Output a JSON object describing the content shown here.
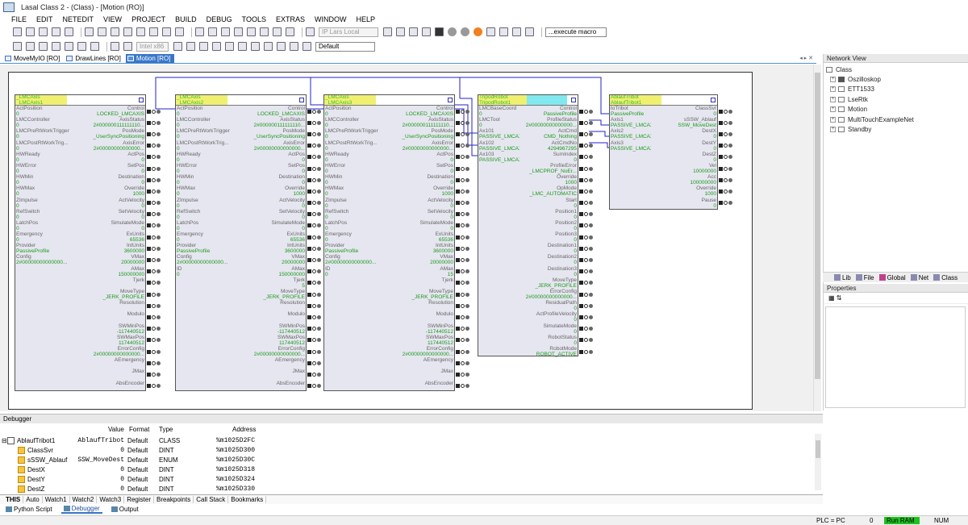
{
  "window": {
    "title": "Lasal Class 2 - (Class) - [Motion (RO)]"
  },
  "menu": [
    "FILE",
    "EDIT",
    "NETEDIT",
    "VIEW",
    "PROJECT",
    "BUILD",
    "DEBUG",
    "TOOLS",
    "EXTRAS",
    "WINDOW",
    "HELP"
  ],
  "toolbar": {
    "target": "IP Lars Local",
    "macro": "...execute macro",
    "platform": "Intel x86",
    "config": "Default"
  },
  "doc_tabs": [
    {
      "label": "MoveMyIO [RO]"
    },
    {
      "label": "DrawLines [RO]"
    },
    {
      "label": "Motion [RO]",
      "active": true
    }
  ],
  "blocks": [
    {
      "name1": "_LMCAxis",
      "name2": "_LMCAxis1",
      "left": [
        [
          "ActPosition",
          "0"
        ],
        [
          "LMCController",
          "0"
        ],
        [
          "LMCPreRtWorkTrigger",
          "0"
        ],
        [
          "LMCPostRtWorkTrig...",
          "0"
        ],
        [
          "HWReady",
          "0"
        ],
        [
          "HWError",
          "0"
        ],
        [
          "HWMin",
          "0"
        ],
        [
          "HWMax",
          "0"
        ],
        [
          "ZImpulse",
          "0"
        ],
        [
          "RefSwitch",
          "0"
        ],
        [
          "LatchPos",
          "0"
        ],
        [
          "Emergency",
          "0"
        ],
        [
          "Provider",
          "PassiveProfile"
        ],
        [
          "Config",
          "2#00000000000000..."
        ]
      ],
      "right": [
        [
          "Control",
          "LOCKED_LMCAXIS"
        ],
        [
          "AxisStatus",
          "2#000000111111110..."
        ],
        [
          "PosMode",
          "_UserSyncPositioning"
        ],
        [
          "AxisError",
          "2#00000000000000..."
        ],
        [
          "ActPos",
          "0"
        ],
        [
          "SetPos",
          "0"
        ],
        [
          "Destination",
          "0"
        ],
        [
          "Override",
          "1000"
        ],
        [
          "ActVelocity",
          "0"
        ],
        [
          "SetVelocity",
          "0"
        ],
        [
          "SimulateMode",
          "0"
        ],
        [
          "ExUnits",
          "65536"
        ],
        [
          "IntUnits",
          "3600000"
        ],
        [
          "VMax",
          "20000000"
        ],
        [
          "AMax",
          "150000000"
        ],
        [
          "Tjerk",
          ""
        ],
        [
          "MoveType",
          "_JERK_PROFILE"
        ],
        [
          "Resolution",
          ""
        ],
        [
          "Modulo",
          ""
        ],
        [
          "SWMinPos",
          "-117440512"
        ],
        [
          "SWMaxPos",
          "117440512"
        ],
        [
          "ErrorConfig",
          "2#00000000000000..."
        ],
        [
          "AEmergency",
          ""
        ],
        [
          "JMax",
          ""
        ],
        [
          "AbsEncoder",
          ""
        ]
      ]
    },
    {
      "name1": "_LMCAxis",
      "name2": "_LMCAxis2",
      "left": [
        [
          "ActPosition",
          "0"
        ],
        [
          "LMCController",
          "0"
        ],
        [
          "LMCPreRtWorkTrigger",
          "0"
        ],
        [
          "LMCPostRtWorkTrig...",
          "0"
        ],
        [
          "HWReady",
          "0"
        ],
        [
          "HWError",
          "0"
        ],
        [
          "HWMin",
          "0"
        ],
        [
          "HWMax",
          "0"
        ],
        [
          "ZImpulse",
          "0"
        ],
        [
          "RefSwitch",
          "0"
        ],
        [
          "LatchPos",
          "0"
        ],
        [
          "Emergency",
          "0"
        ],
        [
          "Provider",
          "PassiveProfile"
        ],
        [
          "Config",
          "2#00000000000000..."
        ],
        [
          "ID",
          "0"
        ]
      ],
      "right": [
        [
          "Control",
          "LOCKED_LMCAXIS"
        ],
        [
          "AxisStatus",
          "2#000000111111110..."
        ],
        [
          "PosMode",
          "_UserSyncPositioning"
        ],
        [
          "AxisError",
          "2#00000000000000..."
        ],
        [
          "ActPos",
          "0"
        ],
        [
          "SetPos",
          "0"
        ],
        [
          "Destination",
          "0"
        ],
        [
          "Override",
          "1000"
        ],
        [
          "ActVelocity",
          "0"
        ],
        [
          "SetVelocity",
          "0"
        ],
        [
          "SimulateMode",
          "0"
        ],
        [
          "ExUnits",
          "65536"
        ],
        [
          "IntUnits",
          "3600000"
        ],
        [
          "VMax",
          "20000000"
        ],
        [
          "AMax",
          "150000000"
        ],
        [
          "Tjerk",
          "5"
        ],
        [
          "MoveType",
          "_JERK_PROFILE"
        ],
        [
          "Resolution",
          ""
        ],
        [
          "Modulo",
          ""
        ],
        [
          "SWMinPos",
          "-117440512"
        ],
        [
          "SWMaxPos",
          "117440512"
        ],
        [
          "ErrorConfig",
          "2#00000000000000..."
        ],
        [
          "AEmergency",
          ""
        ],
        [
          "JMax",
          ""
        ],
        [
          "AbsEncoder",
          ""
        ]
      ]
    },
    {
      "name1": "_LMCAxis",
      "name2": "_LMCAxis3",
      "left": [
        [
          "ActPosition",
          "0"
        ],
        [
          "LMCController",
          "0"
        ],
        [
          "LMCPreRtWorkTrigger",
          "0"
        ],
        [
          "LMCPostRtWorkTrig...",
          "0"
        ],
        [
          "HWReady",
          "0"
        ],
        [
          "HWError",
          "0"
        ],
        [
          "HWMin",
          "0"
        ],
        [
          "HWMax",
          "0"
        ],
        [
          "ZImpulse",
          "0"
        ],
        [
          "RefSwitch",
          "0"
        ],
        [
          "LatchPos",
          "0"
        ],
        [
          "Emergency",
          "0"
        ],
        [
          "Provider",
          "PassiveProfile"
        ],
        [
          "Config",
          "2#00000000000000..."
        ],
        [
          "ID",
          "0"
        ]
      ],
      "right": [
        [
          "Control",
          "LOCKED_LMCAXIS"
        ],
        [
          "AxisStatus",
          "2#000000111111110..."
        ],
        [
          "PosMode",
          "_UserSyncPositioning"
        ],
        [
          "AxisError",
          "2#00000000000000..."
        ],
        [
          "ActPos",
          "0"
        ],
        [
          "SetPos",
          "0"
        ],
        [
          "Destination",
          "0"
        ],
        [
          "Override",
          "1000"
        ],
        [
          "ActVelocity",
          "0"
        ],
        [
          "SetVelocity",
          "0"
        ],
        [
          "SimulateMode",
          "0"
        ],
        [
          "ExUnits",
          "65536"
        ],
        [
          "IntUnits",
          "3600000"
        ],
        [
          "VMax",
          "20000000"
        ],
        [
          "AMax",
          "15"
        ],
        [
          "Tjerk",
          ""
        ],
        [
          "MoveType",
          "_JERK_PROFILE"
        ],
        [
          "Resolution",
          ""
        ],
        [
          "Modulo",
          ""
        ],
        [
          "SWMinPos",
          "-117440512"
        ],
        [
          "SWMaxPos",
          "117440512"
        ],
        [
          "ErrorConfig",
          "2#00000000000000..."
        ],
        [
          "AEmergency",
          ""
        ],
        [
          "JMax",
          ""
        ],
        [
          "AbsEncoder",
          ""
        ]
      ]
    },
    {
      "name1": "TripodRobot",
      "name2": "TripodRobot1",
      "left": [
        [
          "LMCBaseCoord",
          "0"
        ],
        [
          "LMCTool",
          "0"
        ],
        [
          "Ax101",
          "PASSIVE_LMCAXIS"
        ],
        [
          "Ax102",
          "PASSIVE_LMCAXIS"
        ],
        [
          "Ax103",
          "PASSIVE_LMCAXIS"
        ]
      ],
      "right": [
        [
          "Control",
          "PassiveProfile"
        ],
        [
          "ProfileStatus",
          "2#00000000000000..."
        ],
        [
          "ActCmd",
          "CMD_Nothing"
        ],
        [
          "ActCmdNo",
          "4294967295"
        ],
        [
          "SumIndex",
          "0"
        ],
        [
          "ProfileError",
          "_LMCPROF_NoEr..."
        ],
        [
          "Override",
          "1000"
        ],
        [
          "OpMode",
          "_LMC_AUTOMATIC"
        ],
        [
          "Start",
          "0"
        ],
        [
          "Position1",
          "0"
        ],
        [
          "Position2",
          "0"
        ],
        [
          "Position3",
          "0"
        ],
        [
          "Destination1",
          "0"
        ],
        [
          "Destination2",
          "0"
        ],
        [
          "Destination3",
          "0"
        ],
        [
          "MoveType",
          "_JERK_PROFILE"
        ],
        [
          "ErrorConfig",
          "2#00000000000000..."
        ],
        [
          "ResidualPath",
          "0"
        ],
        [
          "ActProfileVelocity",
          "0"
        ],
        [
          "SimulateMode",
          "0"
        ],
        [
          "RobotStatus",
          "0"
        ],
        [
          "RobotMode",
          "ROBOT_ACTIVE"
        ]
      ]
    },
    {
      "name1": "AblaufTribot",
      "name2": "AblaufTribot1",
      "left": [
        [
          "toTribot",
          "PassiveProfile"
        ],
        [
          "Axis1",
          "PASSIVE_LMCAXIS"
        ],
        [
          "Axis2",
          "PASSIVE_LMCAXIS"
        ],
        [
          "Axis3",
          "PASSIVE_LMCAXIS"
        ]
      ],
      "right": [
        [
          "ClassSvr",
          "0"
        ],
        [
          "sSSW_Ablauf",
          "SSW_MoveDest"
        ],
        [
          "DestX",
          "0"
        ],
        [
          "DestY",
          "0"
        ],
        [
          "DestZ",
          "0"
        ],
        [
          "Vel",
          "10000000"
        ],
        [
          "Acc",
          "100000000"
        ],
        [
          "Override",
          "1000"
        ],
        [
          "Pause",
          "0"
        ]
      ]
    }
  ],
  "network_view": {
    "title": "Network View",
    "root": "Class",
    "items": [
      "Oszilloskop",
      "ETT1533",
      "LseRtk",
      "Motion",
      "MultiTouchExampleNet",
      "Standby"
    ]
  },
  "right_tabs": [
    "Lib",
    "File",
    "Global",
    "Net",
    "Class"
  ],
  "properties": {
    "title": "Properties"
  },
  "debugger": {
    "title": "Debugger",
    "columns": [
      "Value",
      "Format",
      "Type",
      "Address"
    ],
    "rows": [
      {
        "name": "AblaufTribot1",
        "value": "AblaufTribot",
        "format": "Default",
        "type": "CLASS",
        "address": "%m1025D2FC"
      },
      {
        "name": "ClassSvr",
        "value": "0",
        "format": "Default",
        "type": "DINT",
        "address": "%m1025D300"
      },
      {
        "name": "sSSW_Ablauf",
        "value": "SSW_MoveDest",
        "format": "Default",
        "type": "ENUM",
        "address": "%m1025D30C"
      },
      {
        "name": "DestX",
        "value": "0",
        "format": "Default",
        "type": "DINT",
        "address": "%m1025D318"
      },
      {
        "name": "DestY",
        "value": "0",
        "format": "Default",
        "type": "DINT",
        "address": "%m1025D324"
      },
      {
        "name": "DestZ",
        "value": "0",
        "format": "Default",
        "type": "DINT",
        "address": "%m1025D330"
      }
    ],
    "tabs": [
      "THIS",
      "Auto",
      "Watch1",
      "Watch2",
      "Watch3",
      "Register",
      "Breakpoints",
      "Call Stack",
      "Bookmarks"
    ]
  },
  "bottom_tabs": [
    "Python Script",
    "Debugger",
    "Output"
  ],
  "status": {
    "plc": "PLC = PC",
    "zero": "0",
    "run": "Run RAM",
    "num": "NUM"
  }
}
